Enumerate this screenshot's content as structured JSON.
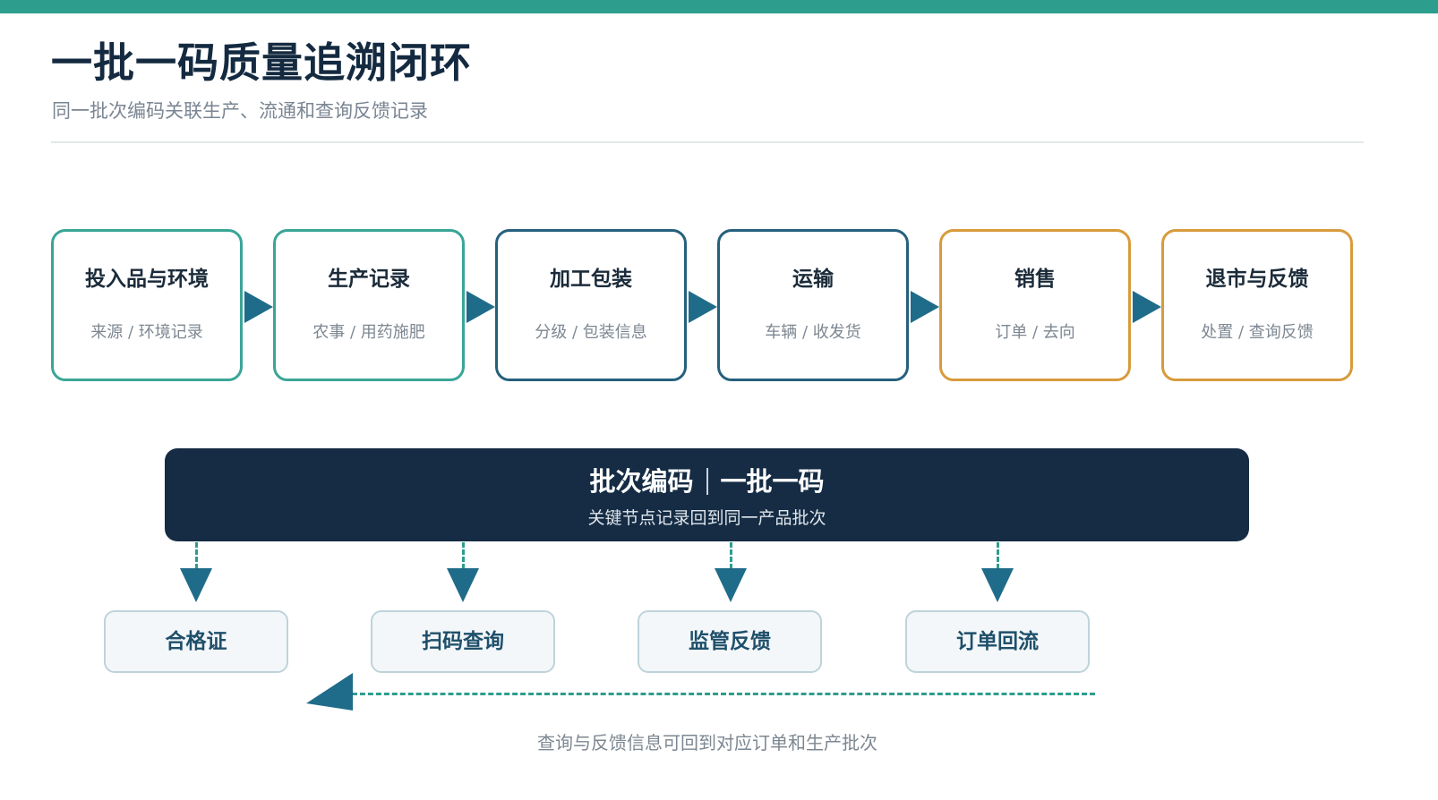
{
  "colors": {
    "top_bar": "#2d9d8d",
    "teal": "#3aa597",
    "blue": "#25607d",
    "gold": "#d89b3c",
    "navy": "#152c44",
    "arrow": "#1f6c8a"
  },
  "header": {
    "title": "一批一码质量追溯闭环",
    "subtitle": "同一批次编码关联生产、流通和查询反馈记录"
  },
  "stages": [
    {
      "title": "投入品与环境",
      "sub": "来源 / 环境记录",
      "tone": "teal"
    },
    {
      "title": "生产记录",
      "sub": "农事 / 用药施肥",
      "tone": "teal"
    },
    {
      "title": "加工包装",
      "sub": "分级 / 包装信息",
      "tone": "blue"
    },
    {
      "title": "运输",
      "sub": "车辆 / 收发货",
      "tone": "blue"
    },
    {
      "title": "销售",
      "sub": "订单 / 去向",
      "tone": "gold"
    },
    {
      "title": "退市与反馈",
      "sub": "处置 / 查询反馈",
      "tone": "gold"
    }
  ],
  "batch": {
    "title_left": "批次编码",
    "title_right": "一批一码",
    "subtitle": "关键节点记录回到同一产品批次"
  },
  "outlets": [
    {
      "label": "合格证"
    },
    {
      "label": "扫码查询"
    },
    {
      "label": "监管反馈"
    },
    {
      "label": "订单回流"
    }
  ],
  "return_caption": "查询与反馈信息可回到对应订单和生产批次"
}
